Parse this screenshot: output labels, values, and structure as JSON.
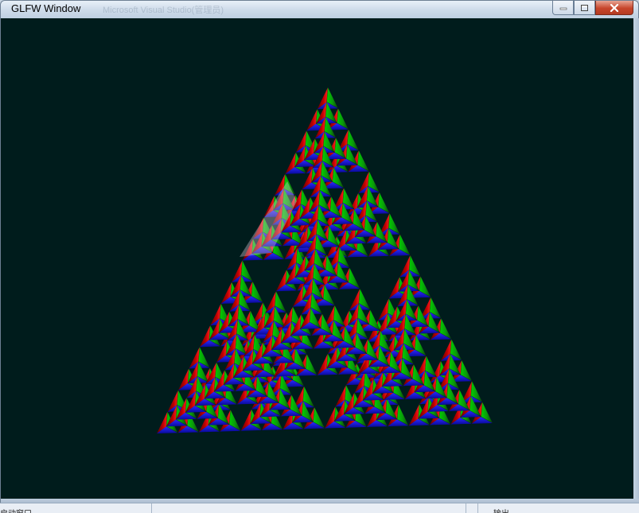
{
  "window": {
    "title": "GLFW Window",
    "background_title": "Microsoft Visual Studio(管理员)",
    "clear_color": "#001c1c"
  },
  "controls": {
    "minimize": "minimize-icon",
    "maximize": "maximize-icon",
    "close": "close-icon"
  },
  "scene": {
    "description_colors": {
      "left_face": "#c00000",
      "right_face": "#0a9a0a",
      "bottom_face": "#1010e6",
      "shadow": "#06122a",
      "highlight": "#e8d8e8"
    }
  },
  "taskbar": {
    "left_text": "启动窗口",
    "right_text": "输出"
  }
}
